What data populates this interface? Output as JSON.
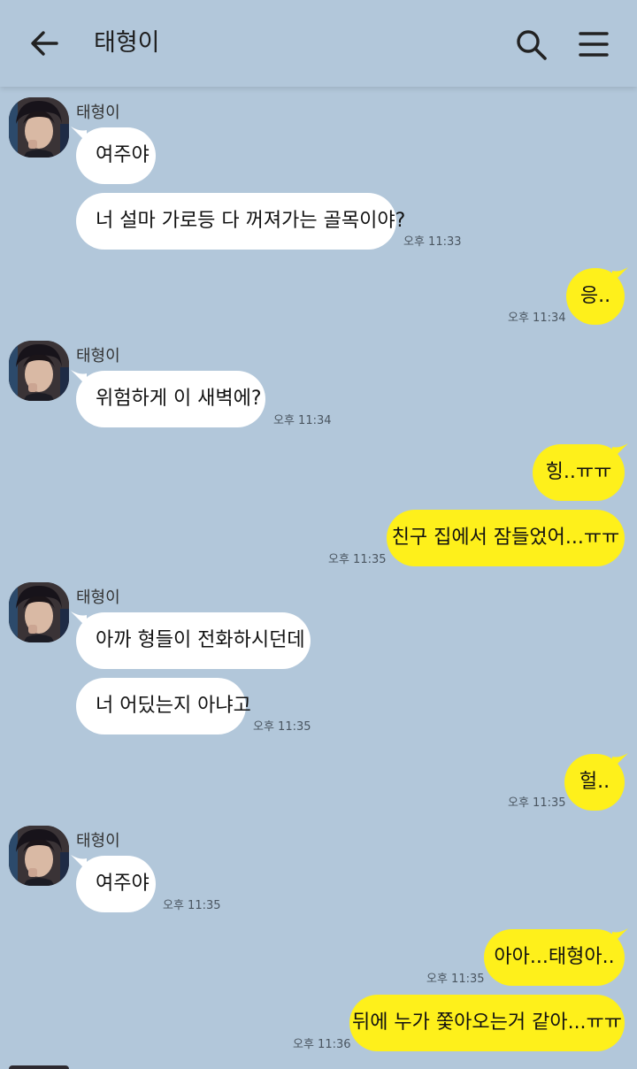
{
  "header": {
    "title": "태형이"
  },
  "contact": {
    "name": "태형이"
  },
  "messages": {
    "m1": "여주야",
    "m2": "너 설마 가로등 다 꺼져가는 골목이야?",
    "t2": "오후 11:33",
    "m3": "응..",
    "t3": "오후 11:34",
    "m4": "위험하게 이 새벽에?",
    "t4": "오후 11:34",
    "m5": "힝..ㅠㅠ",
    "m6": "친구 집에서 잠들었어...ㅠㅠ",
    "t6": "오후 11:35",
    "m7": "아까 형들이 전화하시던데",
    "m8": "너 어딨는지 아냐고",
    "t8": "오후 11:35",
    "m9": "헐..",
    "t9": "오후 11:35",
    "m10": "여주야",
    "t10": "오후 11:35",
    "m11": "아아...태형아..",
    "t11": "오후 11:35",
    "m12": "뒤에 누가 쫓아오는거 같아...ㅠㅠ",
    "t12": "오후 11:36"
  },
  "colors": {
    "background": "#b2c7da",
    "incoming_bubble": "#ffffff",
    "outgoing_bubble": "#fef01b"
  },
  "icons": [
    "back-arrow-icon",
    "search-icon",
    "menu-icon"
  ]
}
